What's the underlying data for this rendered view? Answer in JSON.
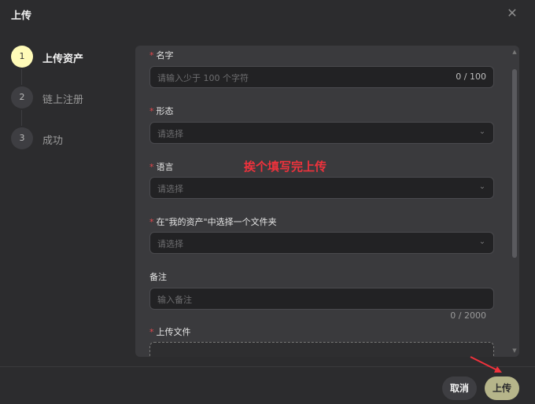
{
  "dialog": {
    "title": "上传",
    "close_icon": "close-icon"
  },
  "steps": [
    {
      "number": "1",
      "label": "上传资产",
      "active": true
    },
    {
      "number": "2",
      "label": "链上注册",
      "active": false
    },
    {
      "number": "3",
      "label": "成功",
      "active": false
    }
  ],
  "form": {
    "name": {
      "label": "名字",
      "required": "*",
      "placeholder": "请输入少于 100 个字符",
      "counter": "0 / 100"
    },
    "form_type": {
      "label": "形态",
      "required": "*",
      "placeholder": "请选择"
    },
    "language": {
      "label": "语言",
      "required": "*",
      "placeholder": "请选择"
    },
    "folder": {
      "label": "在\"我的资产\"中选择一个文件夹",
      "required": "*",
      "placeholder": "请选择"
    },
    "note": {
      "label": "备注",
      "placeholder": "输入备注",
      "counter": "0 / 2000"
    },
    "file": {
      "label": "上传文件",
      "required": "*"
    }
  },
  "annotation": {
    "text": "挨个填写完上传",
    "color": "#f0323c"
  },
  "footer": {
    "cancel_label": "取消",
    "upload_label": "上传"
  },
  "colors": {
    "accent": "#fffbb8",
    "upload_button": "#b6b58a",
    "required": "#e5484d"
  }
}
